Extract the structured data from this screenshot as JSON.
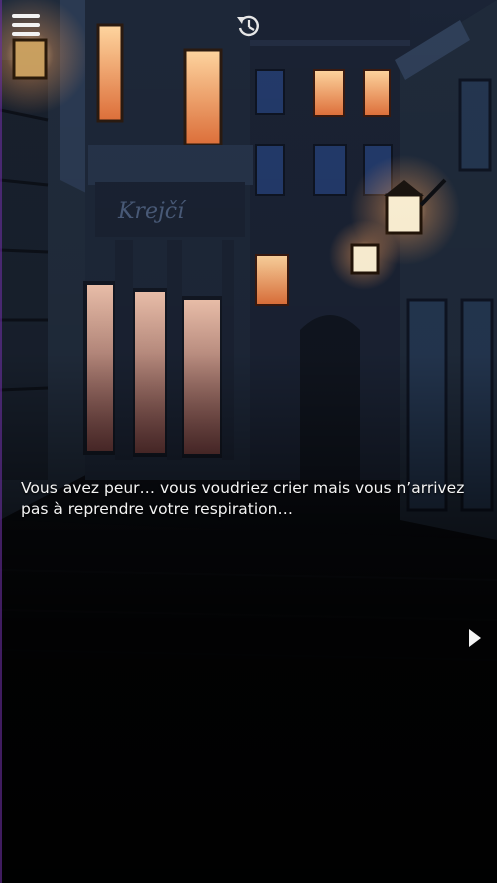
{
  "toolbar": {
    "menu_icon": "hamburger-menu-icon",
    "history_icon": "history-rewind-icon"
  },
  "scene": {
    "shop_sign": "Krejčí"
  },
  "dialogue": {
    "text": "Vous avez peur… vous voudriez crier mais vous n’arrivez pas à reprendre votre respiration…"
  },
  "controls": {
    "advance_icon": "play-triangle-icon"
  },
  "colors": {
    "window_glow": "#f7a05a",
    "lamp_glow": "#ffe7b5",
    "night_blue": "#1b2436",
    "text": "#f4f4f4"
  }
}
